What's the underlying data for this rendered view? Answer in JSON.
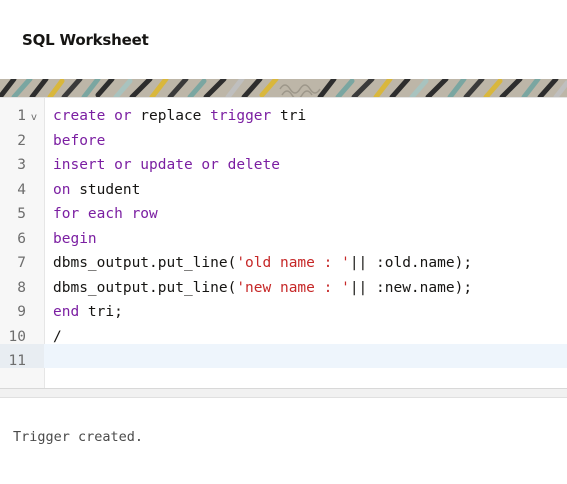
{
  "header": {
    "title": "SQL Worksheet"
  },
  "editor": {
    "lines": [
      {
        "num": "1",
        "tokens": [
          {
            "t": "create or",
            "c": "kw"
          },
          {
            "t": " replace ",
            "c": ""
          },
          {
            "t": "trigger",
            "c": "kw"
          },
          {
            "t": " tri",
            "c": ""
          }
        ]
      },
      {
        "num": "2",
        "tokens": [
          {
            "t": "before",
            "c": "kw"
          }
        ]
      },
      {
        "num": "3",
        "tokens": [
          {
            "t": "insert or update or delete",
            "c": "kw"
          }
        ]
      },
      {
        "num": "4",
        "tokens": [
          {
            "t": "on",
            "c": "kw"
          },
          {
            "t": " student",
            "c": ""
          }
        ]
      },
      {
        "num": "5",
        "tokens": [
          {
            "t": "for each row",
            "c": "kw"
          }
        ]
      },
      {
        "num": "6",
        "tokens": [
          {
            "t": "begin",
            "c": "kw"
          }
        ]
      },
      {
        "num": "7",
        "tokens": [
          {
            "t": "dbms_output.put_line(",
            "c": ""
          },
          {
            "t": "'old name : '",
            "c": "str"
          },
          {
            "t": "|| :old.name);",
            "c": ""
          }
        ]
      },
      {
        "num": "8",
        "tokens": [
          {
            "t": "dbms_output.put_line(",
            "c": ""
          },
          {
            "t": "'new name : '",
            "c": "str"
          },
          {
            "t": "|| :new.name);",
            "c": ""
          }
        ]
      },
      {
        "num": "9",
        "tokens": [
          {
            "t": "end",
            "c": "kw"
          },
          {
            "t": " tri;",
            "c": ""
          }
        ]
      },
      {
        "num": "10",
        "tokens": [
          {
            "t": "/",
            "c": ""
          }
        ]
      },
      {
        "num": "11",
        "tokens": []
      }
    ],
    "fold_marker": "v"
  },
  "output": {
    "text": "Trigger created."
  },
  "colors": {
    "keyword": "#7b1fa2",
    "string": "#c62828",
    "active_line": "#eef5fc"
  },
  "icons": {
    "fold": "chevron-down-icon",
    "banner": "decorative-pattern"
  }
}
